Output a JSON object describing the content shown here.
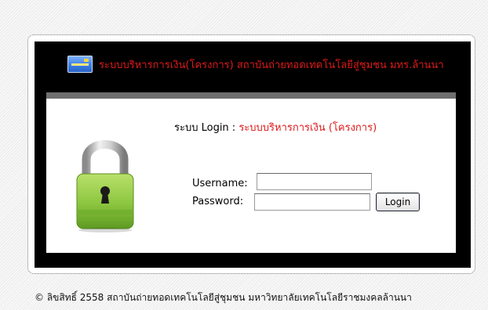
{
  "header": {
    "icon": "credit-card-icon",
    "title": "ระบบบริหารการเงิน(โครงการ) สถาบันถ่ายทอดเทคโนโลยีสู่ชุมชน มทร.ล้านนา"
  },
  "login": {
    "heading_prefix": "ระบบ Login :",
    "heading_system": "ระบบบริหารการเงิน (โครงการ)",
    "username_label": "Username:",
    "username_value": "",
    "password_label": "Password:",
    "password_value": "",
    "submit_label": "Login",
    "lock_icon": "padlock-icon"
  },
  "footer": {
    "copyright": "© ลิขสิทธิ์ 2558 สถาบันถ่ายทอดเทคโนโลยีสู่ชุมชน มหาวิทยาลัยเทคโนโลยีราชมงคลล้านนา"
  },
  "colors": {
    "accent_red": "#e01919",
    "banner_black": "#000000",
    "lock_green": "#8cc63f"
  }
}
